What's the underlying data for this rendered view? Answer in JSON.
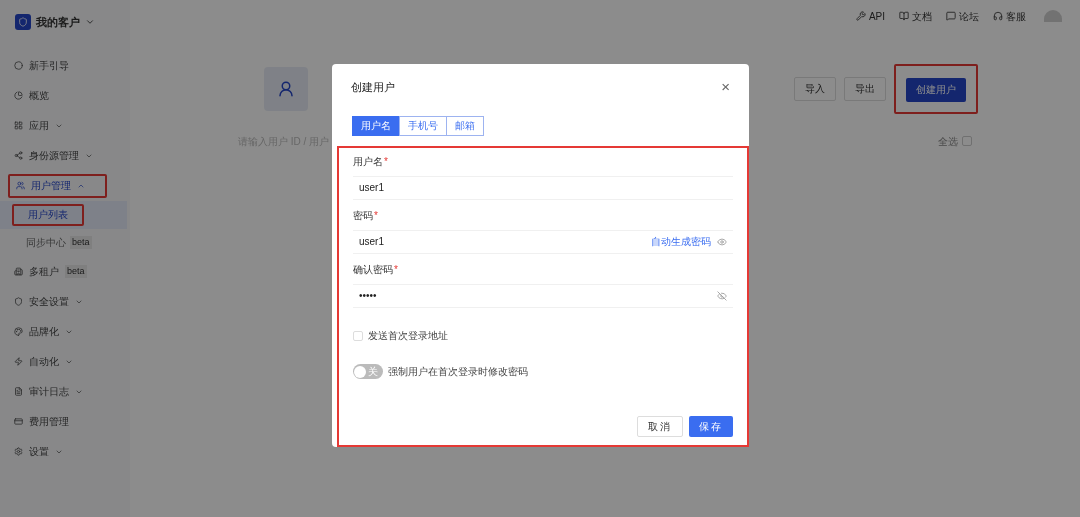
{
  "org": {
    "name": "我的客户"
  },
  "top_links": [
    {
      "label": "API"
    },
    {
      "label": "文档"
    },
    {
      "label": "论坛"
    },
    {
      "label": "客服"
    }
  ],
  "sidebar": {
    "items": [
      {
        "label": "新手引导",
        "expandable": false,
        "highlighted": false
      },
      {
        "label": "概览",
        "expandable": false,
        "highlighted": false
      },
      {
        "label": "应用",
        "expandable": true,
        "expanded": false,
        "highlighted": false
      },
      {
        "label": "身份源管理",
        "expandable": true,
        "expanded": false,
        "highlighted": false
      },
      {
        "label": "用户管理",
        "expandable": true,
        "expanded": true,
        "highlighted": true,
        "children": [
          {
            "label": "用户列表",
            "selected": true,
            "highlighted": true
          },
          {
            "label": "同步中心",
            "badge": "beta",
            "selected": false,
            "highlighted": false
          }
        ]
      },
      {
        "label": "多租户",
        "badge": "beta",
        "expandable": false,
        "highlighted": false
      },
      {
        "label": "安全设置",
        "expandable": true,
        "expanded": false,
        "highlighted": false
      },
      {
        "label": "品牌化",
        "expandable": true,
        "expanded": false,
        "highlighted": false
      },
      {
        "label": "自动化",
        "expandable": true,
        "expanded": false,
        "highlighted": false
      },
      {
        "label": "审计日志",
        "expandable": true,
        "expanded": false,
        "highlighted": false
      },
      {
        "label": "费用管理",
        "expandable": false,
        "highlighted": false
      },
      {
        "label": "设置",
        "expandable": true,
        "expanded": false,
        "highlighted": false
      }
    ]
  },
  "page": {
    "search": {
      "placeholder": "请输入用户 ID / 用户"
    },
    "select_all": {
      "label": "全选",
      "checked": false
    },
    "buttons": [
      {
        "label": "导入",
        "primary": false,
        "highlighted": false
      },
      {
        "label": "导出",
        "primary": false,
        "highlighted": false
      },
      {
        "label": "创建用户",
        "primary": true,
        "highlighted": true
      }
    ]
  },
  "dialog": {
    "title": "创建用户",
    "close": "×",
    "tabs": [
      {
        "label": "用户名",
        "selected": true
      },
      {
        "label": "手机号",
        "selected": false
      },
      {
        "label": "邮箱",
        "selected": false
      }
    ],
    "highlighted": true,
    "fields": [
      {
        "label": "用户名",
        "required_mark": "*",
        "kind": "text",
        "value": "user1"
      },
      {
        "label": "密码",
        "required_mark": "*",
        "kind": "password",
        "visible": true,
        "value": "user1",
        "link": "自动生成密码"
      },
      {
        "label": "确认密码",
        "required_mark": "*",
        "kind": "password",
        "visible": false,
        "value": "•••••"
      }
    ],
    "checkbox": {
      "label": "发送首次登录地址",
      "checked": false
    },
    "switch": {
      "label": "强制用户在首次登录时修改密码",
      "on": false,
      "state_text": "关"
    },
    "buttons": [
      {
        "label": "取消",
        "primary": false
      },
      {
        "label": "保存",
        "primary": true
      }
    ]
  }
}
